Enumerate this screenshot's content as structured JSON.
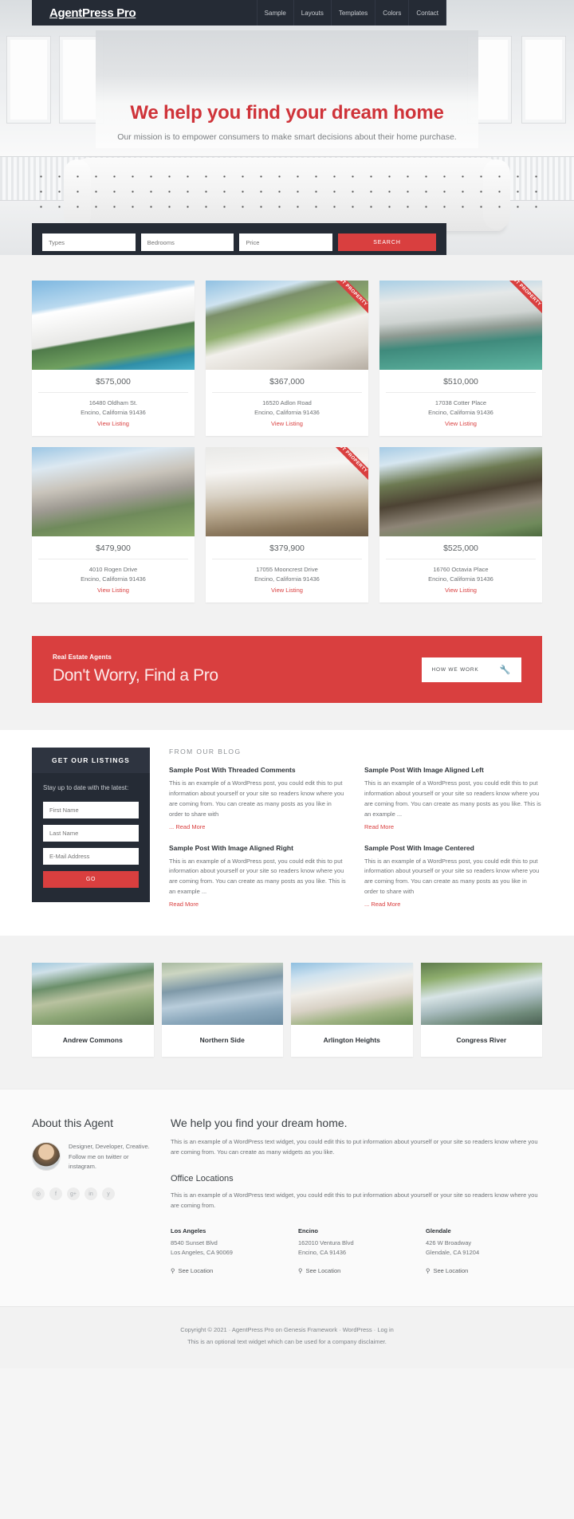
{
  "header": {
    "brand": "AgentPress Pro",
    "nav": [
      {
        "label": "Sample"
      },
      {
        "label": "Layouts"
      },
      {
        "label": "Templates"
      },
      {
        "label": "Colors"
      },
      {
        "label": "Contact"
      }
    ]
  },
  "hero": {
    "title": "We help you find your dream home",
    "subtitle": "Our mission is to empower consumers to make smart decisions about their home purchase."
  },
  "search": {
    "types_placeholder": "Types",
    "bedrooms_placeholder": "Bedrooms",
    "price_placeholder": "Price",
    "button": "SEARCH"
  },
  "listings": [
    {
      "price": "$575,000",
      "address1": "16480 Oldham St.",
      "address2": "Encino, California 91436",
      "link": "View Listing",
      "ribbon": ""
    },
    {
      "price": "$367,000",
      "address1": "16520 Adlon Road",
      "address2": "Encino, California 91436",
      "link": "View Listing",
      "ribbon": "HOT PROPERTY"
    },
    {
      "price": "$510,000",
      "address1": "17038 Cotter Place",
      "address2": "Encino, California 91436",
      "link": "View Listing",
      "ribbon": "HOT PROPERTY"
    },
    {
      "price": "$479,900",
      "address1": "4010 Rogen Drive",
      "address2": "Encino, California 91436",
      "link": "View Listing",
      "ribbon": ""
    },
    {
      "price": "$379,900",
      "address1": "17055 Mooncrest Drive",
      "address2": "Encino, California 91436",
      "link": "View Listing",
      "ribbon": "HOT PROPERTY"
    },
    {
      "price": "$525,000",
      "address1": "16760 Octavia Place",
      "address2": "Encino, California 91436",
      "link": "View Listing",
      "ribbon": ""
    }
  ],
  "cta": {
    "eyebrow": "Real Estate Agents",
    "title": "Don't Worry, Find a Pro",
    "button": "HOW WE WORK",
    "icon": "wrench-icon"
  },
  "sidebar": {
    "title": "GET OUR LISTINGS",
    "note": "Stay up to date with the latest:",
    "first_name_placeholder": "First Name",
    "last_name_placeholder": "Last Name",
    "email_placeholder": "E-Mail Address",
    "submit": "GO"
  },
  "blog": {
    "heading": "FROM OUR BLOG",
    "posts": [
      {
        "title": "Sample Post With Threaded Comments",
        "excerpt": "This is an example of a WordPress post, you could edit this to put information about yourself or your site so readers know where you are coming from. You can create as many posts as you like in order to share with",
        "more": "... Read More"
      },
      {
        "title": "Sample Post With Image Aligned Left",
        "excerpt": "This is an example of a WordPress post, you could edit this to put information about yourself or your site so readers know where you are coming from. You can create as many posts as you like. This is an example ...",
        "more": "Read More"
      },
      {
        "title": "Sample Post With Image Aligned Right",
        "excerpt": "This is an example of a WordPress post, you could edit this to put information about yourself or your site so readers know where you are coming from. You can create as many posts as you like. This is an example ...",
        "more": "Read More"
      },
      {
        "title": "Sample Post With Image Centered",
        "excerpt": "This is an example of a WordPress post, you could edit this to put information about yourself or your site so readers know where you are coming from. You can create as many posts as you like in order to share with",
        "more": "... Read More"
      }
    ]
  },
  "neighborhoods": [
    {
      "name": "Andrew Commons"
    },
    {
      "name": "Northern Side"
    },
    {
      "name": "Arlington Heights"
    },
    {
      "name": "Congress River"
    }
  ],
  "footer": {
    "about_title": "About this Agent",
    "agent_bio": "Designer, Developer, Creative. Follow me on twitter or instagram.",
    "socials": [
      {
        "icon": "dribbble-icon",
        "glyph": "◎"
      },
      {
        "icon": "facebook-icon",
        "glyph": "f"
      },
      {
        "icon": "google-plus-icon",
        "glyph": "g+"
      },
      {
        "icon": "linkedin-icon",
        "glyph": "in"
      },
      {
        "icon": "twitter-icon",
        "glyph": "y"
      }
    ],
    "main_title": "We help you find your dream home.",
    "main_text": "This is an example of a WordPress text widget, you could edit this to put information about yourself or your site so readers know where you are coming from. You can create as many widgets as you like.",
    "offices_title": "Office Locations",
    "offices_text": "This is an example of a WordPress text widget, you could edit this to put information about yourself or your site so readers know where you are coming from.",
    "offices": [
      {
        "name": "Los Angeles",
        "line1": "8540 Sunset Blvd",
        "line2": "Los Angeles, CA 90069",
        "link": "See Location"
      },
      {
        "name": "Encino",
        "line1": "162010 Ventura Blvd",
        "line2": "Encino, CA 91436",
        "link": "See Location"
      },
      {
        "name": "Glendale",
        "line1": "426 W Broadway",
        "line2": "Glendale, CA 91204",
        "link": "See Location"
      }
    ]
  },
  "credits": {
    "line1": "Copyright © 2021 · AgentPress Pro on Genesis Framework · WordPress · Log in",
    "line2": "This is an optional text widget which can be used for a company disclaimer."
  },
  "colors": {
    "accent": "#d93f3f",
    "dark": "#252b35",
    "hero_title": "#cf3339"
  }
}
